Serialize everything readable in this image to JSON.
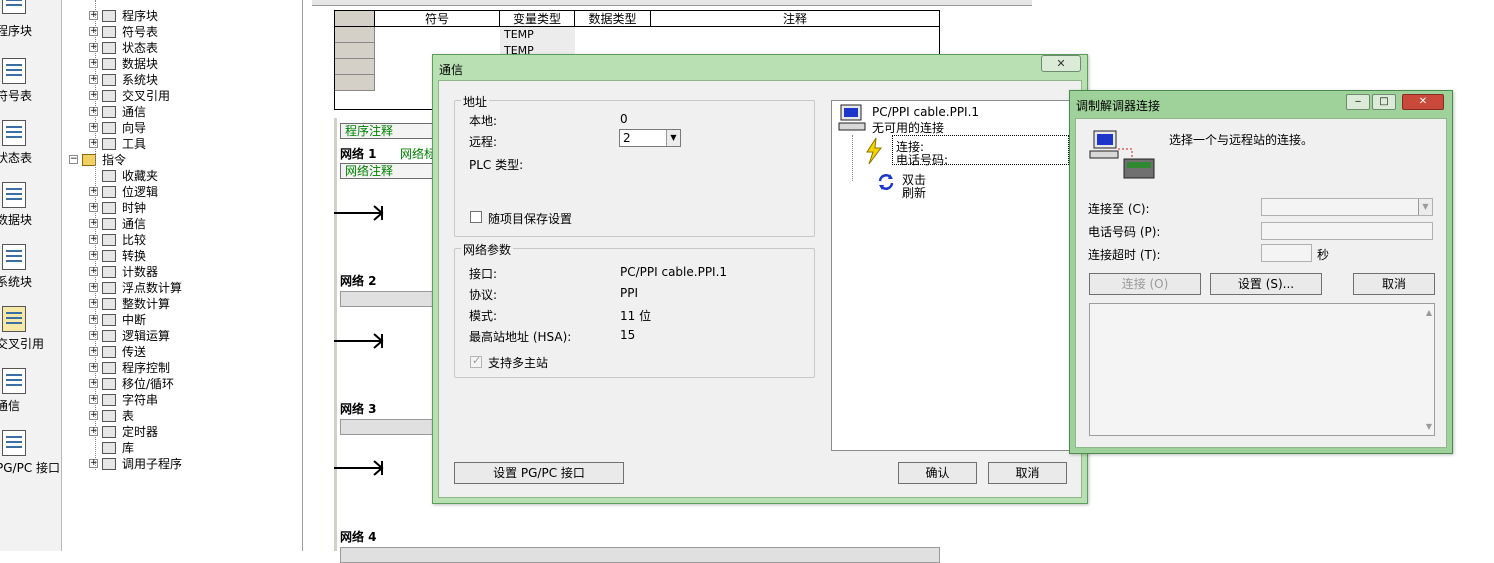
{
  "navbar": {
    "items": [
      {
        "label": "程序块",
        "icon": "program-block-icon"
      },
      {
        "label": "符号表",
        "icon": "symbol-table-icon"
      },
      {
        "label": "状态表",
        "icon": "status-table-icon"
      },
      {
        "label": "数据块",
        "icon": "data-block-icon"
      },
      {
        "label": "系统块",
        "icon": "system-block-icon"
      },
      {
        "label": "交叉引用",
        "icon": "cross-reference-icon"
      },
      {
        "label": "通信",
        "icon": "communication-icon"
      },
      {
        "label": "PG/PC 接口",
        "icon": "pgpc-interface-icon"
      }
    ]
  },
  "tree": {
    "items": [
      {
        "label": "程序块",
        "level": 1,
        "expander": "+"
      },
      {
        "label": "符号表",
        "level": 1,
        "expander": "+"
      },
      {
        "label": "状态表",
        "level": 1,
        "expander": "+"
      },
      {
        "label": "数据块",
        "level": 1,
        "expander": "+"
      },
      {
        "label": "系统块",
        "level": 1,
        "expander": "+"
      },
      {
        "label": "交叉引用",
        "level": 1,
        "expander": "+"
      },
      {
        "label": "通信",
        "level": 1,
        "expander": "+"
      },
      {
        "label": "向导",
        "level": 1,
        "expander": "+"
      },
      {
        "label": "工具",
        "level": 1,
        "expander": "+"
      },
      {
        "label": "指令",
        "level": 0,
        "expander": "-"
      },
      {
        "label": "收藏夹",
        "level": 1,
        "expander": ""
      },
      {
        "label": "位逻辑",
        "level": 1,
        "expander": "+"
      },
      {
        "label": "时钟",
        "level": 1,
        "expander": "+"
      },
      {
        "label": "通信",
        "level": 1,
        "expander": "+"
      },
      {
        "label": "比较",
        "level": 1,
        "expander": "+"
      },
      {
        "label": "转换",
        "level": 1,
        "expander": "+"
      },
      {
        "label": "计数器",
        "level": 1,
        "expander": "+"
      },
      {
        "label": "浮点数计算",
        "level": 1,
        "expander": "+"
      },
      {
        "label": "整数计算",
        "level": 1,
        "expander": "+"
      },
      {
        "label": "中断",
        "level": 1,
        "expander": "+"
      },
      {
        "label": "逻辑运算",
        "level": 1,
        "expander": "+"
      },
      {
        "label": "传送",
        "level": 1,
        "expander": "+"
      },
      {
        "label": "程序控制",
        "level": 1,
        "expander": "+"
      },
      {
        "label": "移位/循环",
        "level": 1,
        "expander": "+"
      },
      {
        "label": "字符串",
        "level": 1,
        "expander": "+"
      },
      {
        "label": "表",
        "level": 1,
        "expander": "+"
      },
      {
        "label": "定时器",
        "level": 1,
        "expander": "+"
      },
      {
        "label": "库",
        "level": 1,
        "expander": ""
      },
      {
        "label": "调用子程序",
        "level": 1,
        "expander": "+"
      }
    ]
  },
  "symbol_table": {
    "headers": [
      "符号",
      "变量类型",
      "数据类型",
      "注释"
    ],
    "rows": [
      {
        "var_type": "TEMP"
      },
      {
        "var_type": "TEMP"
      }
    ]
  },
  "editor": {
    "program_comment": "程序注释",
    "networks": [
      {
        "title": "网络 1",
        "inline_comment": "网络标",
        "comment": "网络注释"
      },
      {
        "title": "网络 2"
      },
      {
        "title": "网络 3"
      },
      {
        "title": "网络 4"
      }
    ]
  },
  "comm_dialog": {
    "title": "通信",
    "close_label": "✕",
    "address_group": "地址",
    "local_label": "本地:",
    "local_value": "0",
    "remote_label": "远程:",
    "remote_value": "2",
    "plc_type_label": "PLC 类型:",
    "save_with_project": "随项目保存设置",
    "network_group": "网络参数",
    "interface_label": "接口:",
    "interface_value": "PC/PPI cable.PPI.1",
    "protocol_label": "协议:",
    "protocol_value": "PPI",
    "mode_label": "模式:",
    "mode_value": "11 位",
    "hsa_label": "最高站地址 (HSA):",
    "hsa_value": "15",
    "multimaster_label": "支持多主站",
    "tree_cable": "PC/PPI cable.PPI.1",
    "tree_no_connection": "无可用的连接",
    "tree_connect": "连接:",
    "tree_phone": "电话号码:",
    "tree_double_click": "双击",
    "tree_refresh": "刷新",
    "setup_pgpc_button": "设置 PG/PC 接口",
    "ok_button": "确认",
    "cancel_button": "取消"
  },
  "modem_dialog": {
    "title": "调制解调器连接",
    "minimize": "‒",
    "maximize": "□",
    "close": "✕",
    "prompt": "选择一个与远程站的连接。",
    "connect_to_label": "连接至 (C):",
    "phone_label": "电话号码 (P):",
    "timeout_label": "连接超时 (T):",
    "seconds": "秒",
    "connect_button": "连接 (O)",
    "settings_button": "设置 (S)...",
    "cancel_button": "取消"
  }
}
